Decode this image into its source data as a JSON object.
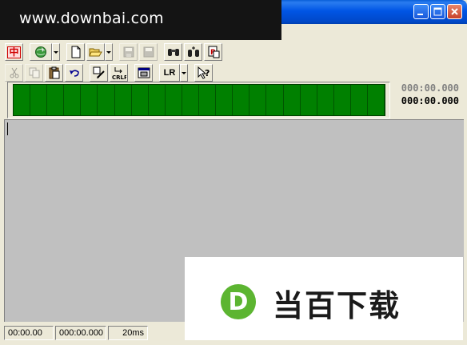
{
  "window": {
    "watermark_text": "www.downbai.com"
  },
  "toolbar1": {
    "buttons": [
      {
        "icon": "chinese-char-icon",
        "glyph": "中"
      },
      {
        "icon": "globe-icon"
      },
      {
        "icon": "new-file-icon"
      },
      {
        "icon": "open-folder-icon"
      },
      {
        "icon": "save-icon"
      },
      {
        "icon": "save-as-icon"
      },
      {
        "icon": "find-icon"
      },
      {
        "icon": "find-next-icon"
      },
      {
        "icon": "replace-icon"
      }
    ]
  },
  "toolbar2": {
    "buttons": [
      {
        "icon": "cut-icon"
      },
      {
        "icon": "copy-icon"
      },
      {
        "icon": "paste-icon"
      },
      {
        "icon": "undo-icon"
      },
      {
        "icon": "edit-tool-icon"
      },
      {
        "icon": "crlf-icon",
        "label": "CRLF"
      },
      {
        "icon": "window-icon"
      },
      {
        "icon": "help-pointer-icon",
        "label": "?"
      }
    ],
    "lr_label": "LR"
  },
  "meter": {
    "time_top": "000:00.000",
    "time_bottom": "000:00.000",
    "color": "#008000"
  },
  "status": {
    "cell1": "00:00.00",
    "cell2": "000:00.000",
    "cell3": "20ms"
  },
  "brand": {
    "logo_letter": "D",
    "text": "当百下载",
    "logo_color": "#5cb531"
  }
}
